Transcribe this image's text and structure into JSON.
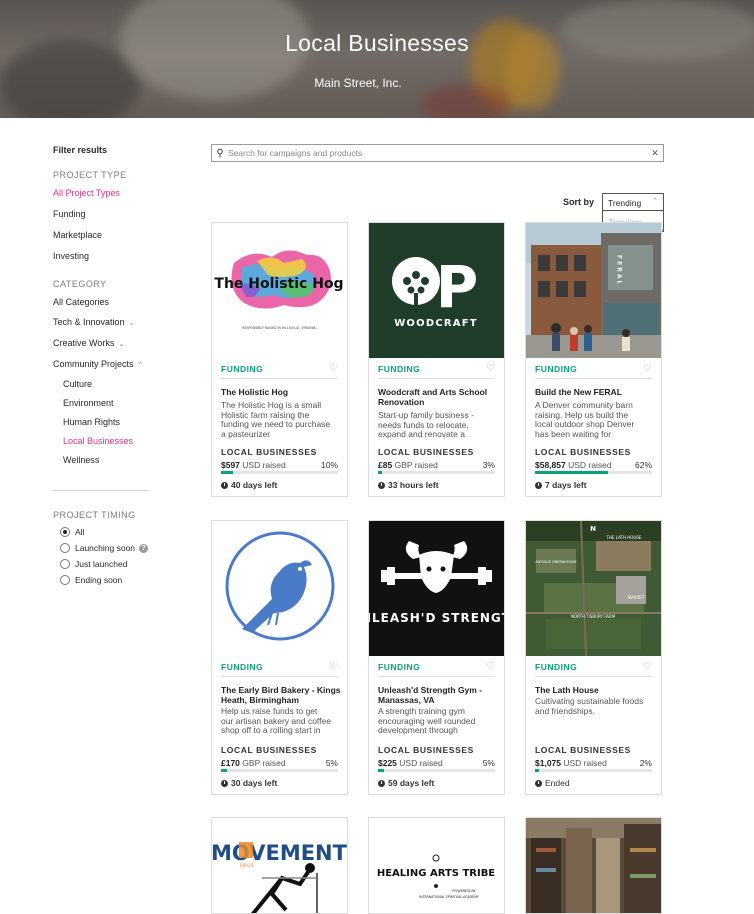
{
  "hero": {
    "title": "Local Businesses",
    "subtitle": "Main Street, Inc."
  },
  "sidebar": {
    "filter_title": "Filter results",
    "project_type_heading": "PROJECT TYPE",
    "project_types": [
      "All Project Types",
      "Funding",
      "Marketplace",
      "Investing"
    ],
    "selected_project_type": "All Project Types",
    "category_heading": "CATEGORY",
    "categories": [
      "All Categories",
      "Tech & Innovation",
      "Creative Works",
      "Community Projects"
    ],
    "community_subcategories": [
      "Culture",
      "Environment",
      "Human Rights",
      "Local Businesses",
      "Wellness"
    ],
    "selected_subcategory": "Local Businesses",
    "timing_heading": "PROJECT TIMING",
    "timing_options": [
      "All",
      "Launching soon",
      "Just launched",
      "Ending soon"
    ],
    "selected_timing": "All"
  },
  "search": {
    "placeholder": "Search for campaigns and products",
    "value": ""
  },
  "sort": {
    "label": "Sort by",
    "selected": "Trending",
    "options": [
      "Trending"
    ]
  },
  "colors": {
    "accent_pink": "#e2337a",
    "funding_green": "#07a47a"
  },
  "cards": [
    {
      "type": "FUNDING",
      "title": "The Holistic Hog",
      "desc": "The Holistic Hog is a small Holistic farm raising the funding we need to purchase a pasteurizer",
      "category": "LOCAL BUSINESSES",
      "amount": "$597",
      "currency": "USD raised",
      "percent": "10%",
      "progress": 10,
      "time": "40 days left",
      "image_text": "The Holistic Hog"
    },
    {
      "type": "FUNDING",
      "title": "Woodcraft and Arts School Renovation",
      "desc": "Start-up family business - needs funds to relocate, expand and renovate a rundown rural workshop",
      "category": "LOCAL BUSINESSES",
      "amount": "£85",
      "currency": "GBP raised",
      "percent": "3%",
      "progress": 3,
      "time": "33 hours left",
      "image_text": "WOODCRAFT"
    },
    {
      "type": "FUNDING",
      "title": "Build the New FERAL",
      "desc": "A Denver community barn raising. Help us build the local outdoor shop Denver has been waiting for",
      "category": "LOCAL BUSINESSES",
      "amount": "$58,857",
      "currency": "USD raised",
      "percent": "62%",
      "progress": 62,
      "time": "7 days left",
      "image_text": "FERAL"
    },
    {
      "type": "FUNDING",
      "title": "The Early Bird Bakery - Kings Heath, Birmingham",
      "desc": "Help us raise funds to get our artisan bakery and coffee shop off to a rolling start in Birmingham!",
      "category": "LOCAL BUSINESSES",
      "amount": "£170",
      "currency": "GBP raised",
      "percent": "5%",
      "progress": 5,
      "time": "30 days left",
      "image_text": ""
    },
    {
      "type": "FUNDING",
      "title": "Unleash'd Strength Gym - Manassas, VA",
      "desc": "A strength training gym encouraging well rounded development through discipline and virtue",
      "category": "LOCAL BUSINESSES",
      "amount": "$225",
      "currency": "USD raised",
      "percent": "5%",
      "progress": 5,
      "time": "59 days left",
      "image_text": "UNLEASH'D STRENGTH"
    },
    {
      "type": "FUNDING",
      "title": "The Lath House",
      "desc": "Cultivating sustainable foods and friendships.",
      "category": "LOCAL BUSINESSES",
      "amount": "$1,075",
      "currency": "USD raised",
      "percent": "2%",
      "progress": 2,
      "time": "Ended",
      "image_text": "THE LATH HOUSE"
    },
    {
      "image_text": "MOVEMENT"
    },
    {
      "image_text": "HEALING ARTS TRIBE"
    },
    {
      "image_text": ""
    }
  ],
  "image_labels": {
    "hog_sub": "RESPONSIBLY RAISED IN HILLSVILLE, VIRGINIA",
    "woodcraft_mark": "P",
    "lath_labels": [
      "ANTIQUE GREENHOUSE",
      "MARKET",
      "NORTH TISBURY FARM"
    ],
    "movement_sub": "BRAZIL",
    "tribe_sub1": "POWERED BY",
    "tribe_sub2": "INTERNATIONAL SPIRITUAL ACADEMY"
  }
}
